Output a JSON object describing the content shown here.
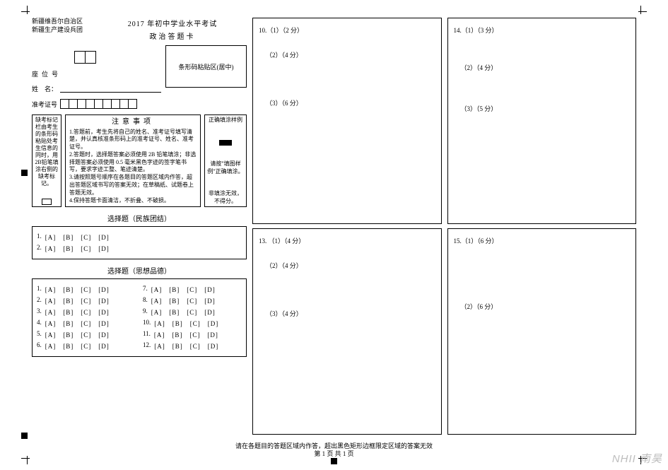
{
  "header": {
    "region_line1": "新疆维吾尔自治区",
    "region_line2": "新疆生产建设兵团",
    "title_main": "2017 年初中学业水平考试",
    "title_sub": "政治答题卡"
  },
  "fields": {
    "seat_label": "座位号",
    "name_label": "姓　名：",
    "exam_no_label": "准考证号",
    "barcode_label": "条形码粘贴区(居中)"
  },
  "warn_box": {
    "text": "缺考标记栏由考生的条形码粘贴处考生信息的同时，用2B铅笔填涂右侧的缺考标记。"
  },
  "notice": {
    "title": "注意事项",
    "line1": "1.答题前，考生先将自己的姓名、准考证号填写清楚，并认真核准条形码上的准考证号、姓名、准考证号。",
    "line2": "2.答题时，选择题答案必须使用 2B 铅笔填涂；非选择题答案必须使用 0.5 毫米黑色字迹的签字笔书写，要求字迹工整、笔迹清楚。",
    "line3": "3.请按照题号顺序在各题目的答题区域内作答，超出答题区域书写的答案无效；在草稿纸、试题卷上答题无效。",
    "line4": "4.保持答题卡面清洁，不折叠、不破损。"
  },
  "fill_example": {
    "title": "正确填涂样例",
    "l1": "请按\"填图样例\"正确填涂。",
    "l2": "非填涂无效，不得分。"
  },
  "sections": {
    "mc1_title": "选择题（民族团结）",
    "mc2_title": "选择题（思想品德）"
  },
  "mc1": [
    {
      "n": "1.",
      "opts": "[A]　[B]　[C]　[D]"
    },
    {
      "n": "2.",
      "opts": "[A]　[B]　[C]　[D]"
    }
  ],
  "mc2_left": [
    {
      "n": "1.",
      "opts": "[A]　[B]　[C]　[D]"
    },
    {
      "n": "2.",
      "opts": "[A]　[B]　[C]　[D]"
    },
    {
      "n": "3.",
      "opts": "[A]　[B]　[C]　[D]"
    },
    {
      "n": "4.",
      "opts": "[A]　[B]　[C]　[D]"
    },
    {
      "n": "5.",
      "opts": "[A]　[B]　[C]　[D]"
    },
    {
      "n": "6.",
      "opts": "[A]　[B]　[C]　[D]"
    }
  ],
  "mc2_right": [
    {
      "n": "7.",
      "opts": "[A]　[B]　[C]　[D]"
    },
    {
      "n": "8.",
      "opts": "[A]　[B]　[C]　[D]"
    },
    {
      "n": "9.",
      "opts": "[A]　[B]　[C]　[D]"
    },
    {
      "n": "10.",
      "opts": "[A]　[B]　[C]　[D]"
    },
    {
      "n": "11.",
      "opts": "[A]　[B]　[C]　[D]"
    },
    {
      "n": "12.",
      "opts": "[A]　[B]　[C]　[D]"
    }
  ],
  "col2": {
    "q10": {
      "head": "10.（1）（2 分）",
      "s2": "（2）（4 分）",
      "s3": "（3）（6 分）"
    },
    "q13": {
      "head": "13. （1）（4 分）",
      "s2": "（2）（4 分）",
      "s3": "（3）（4 分）"
    }
  },
  "col3": {
    "q14": {
      "head": "14.（1）（3 分）",
      "s2": "（2）（4 分）",
      "s3": "（3）（5 分）"
    },
    "q15": {
      "head": "15.（1）（6 分）",
      "s2": "（2）（6 分）"
    }
  },
  "footer": {
    "line1": "请在各题目的答题区域内作答，超出黑色矩形边框限定区域的答案无效",
    "line2": "第 1 页 共 1 页"
  },
  "watermark": "NHII 南昊"
}
